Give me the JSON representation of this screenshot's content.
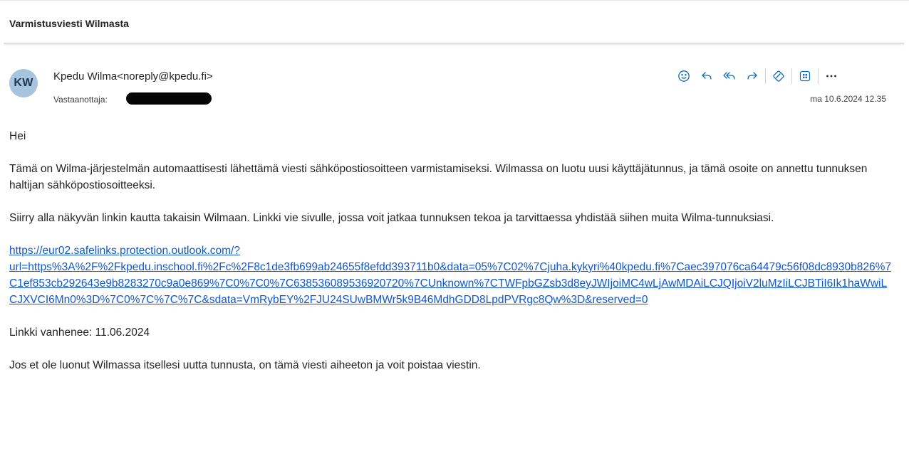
{
  "subject": "Varmistusviesti Wilmasta",
  "header": {
    "avatar_initials": "KW",
    "avatar_color": "#a7c4de",
    "sender": "Kpedu Wilma<noreply@kpedu.fi>",
    "recipient_label": "Vastaanottaja:",
    "date": "ma 10.6.2024 12.35"
  },
  "toolbar": {
    "icons": [
      "emoji-icon",
      "reply-icon",
      "reply-all-icon",
      "forward-icon",
      "sticker-icon",
      "apps-icon",
      "more-icon"
    ],
    "accent": "#0f6cbd"
  },
  "body": {
    "greeting": "Hei",
    "para1": "Tämä on Wilma-järjestelmän automaattisesti lähettämä viesti sähköpostiosoitteen varmistamiseksi. Wilmassa on luotu uusi käyttäjätunnus, ja tämä osoite on annettu tunnuksen haltijan sähköpostiosoitteeksi.",
    "para2": "Siirry alla näkyvän linkin kautta takaisin Wilmaan. Linkki vie sivulle, jossa voit jatkaa tunnuksen tekoa ja tarvittaessa yhdistää siihen muita Wilma-tunnuksiasi.",
    "link_line1": "https://eur02.safelinks.protection.outlook.com/?",
    "link_rest": "url=https%3A%2F%2Fkpedu.inschool.fi%2Fc%2F8c1de3fb699ab24655f8efdd393711b0&data=05%7C02%7Cjuha.kykyri%40kpedu.fi%7Caec397076ca64479c56f08dc8930b826%7C1ef853cb292643e9b8283270c9a0e869%7C0%7C0%7C638536089536920720%7CUnknown%7CTWFpbGZsb3d8eyJWIjoiMC4wLjAwMDAiLCJQIjoiV2luMzIiLCJBTiI6Ik1haWwiLCJXVCI6Mn0%3D%7C0%7C%7C%7C&sdata=VmRybEY%2FJU24SUwBMWr5k9B46MdhGDD8LpdPVRgc8Qw%3D&reserved=0",
    "expiry": "Linkki vanhenee: 11.06.2024",
    "closing": "Jos et ole luonut Wilmassa itsellesi uutta tunnusta, on tämä viesti aiheeton ja voit poistaa viestin."
  }
}
